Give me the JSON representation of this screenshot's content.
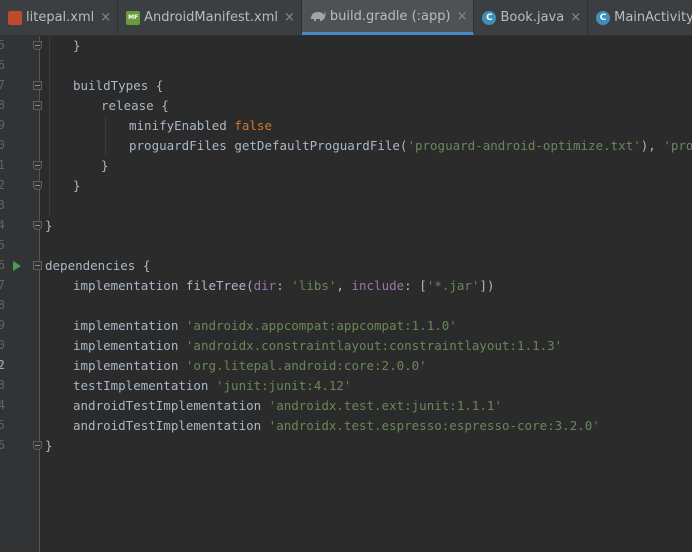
{
  "tabs": [
    {
      "label": "litepal.xml",
      "icon": "xml-file-icon",
      "icon_text": "",
      "active": false
    },
    {
      "label": "AndroidManifest.xml",
      "icon": "manifest-file-icon",
      "icon_text": "MF",
      "active": false
    },
    {
      "label": "build.gradle (:app)",
      "icon": "gradle-icon",
      "icon_text": "",
      "active": true
    },
    {
      "label": "Book.java",
      "icon": "java-class-icon",
      "icon_text": "C",
      "active": false
    },
    {
      "label": "MainActivity.java",
      "icon": "java-class-icon",
      "icon_text": "C",
      "active": false
    }
  ],
  "close_glyph": "×",
  "line_numbers": [
    "5",
    "6",
    "7",
    "8",
    "9",
    "0",
    "1",
    "2",
    "3",
    "4",
    "5",
    "6",
    "7",
    "8",
    "9",
    "0",
    "1",
    "2",
    "3",
    "4",
    "5",
    "6"
  ],
  "code": {
    "l1": "}",
    "buildTypes": "buildTypes {",
    "release": "release {",
    "minify_key": "minifyEnabled ",
    "minify_val": "false",
    "proguard_fn": "proguardFiles getDefaultProguardFile(",
    "proguard_arg1": "'proguard-android-optimize.txt'",
    "proguard_sep": "), ",
    "proguard_arg2": "'proguard-",
    "close_release": "}",
    "close_buildtypes": "}",
    "close_android": "}",
    "dependencies": "dependencies {",
    "impl_filetree_a": "implementation fileTree(",
    "dir_key": "dir",
    "colon_sp": ": ",
    "libs": "'libs'",
    "comma": ", ",
    "include_key": "include",
    "bracket_open": "[",
    "jar": "'*.jar'",
    "bracket_close": "])",
    "impl_kw": "implementation ",
    "dep_appcompat": "'androidx.appcompat:appcompat:1.1.0'",
    "dep_constraint": "'androidx.constraintlayout:constraintlayout:1.1.3'",
    "dep_litepal": "'org.litepal.android:core:2.0.0'",
    "test_impl": "testImplementation ",
    "dep_junit": "'junit:junit:4.12'",
    "android_test_impl": "androidTestImplementation ",
    "dep_ext_junit": "'androidx.test.ext:junit:1.1.1'",
    "dep_espresso": "'androidx.test.espresso:espresso-core:3.2.0'",
    "close_deps": "}"
  },
  "colors": {
    "background": "#2b2b2b",
    "gutter": "#313335",
    "keyword": "#cc7832",
    "string": "#6a8759",
    "named_arg": "#9876aa",
    "text": "#a9b7c6",
    "active_tab_underline": "#4a88c7",
    "run_icon": "#499c54"
  }
}
